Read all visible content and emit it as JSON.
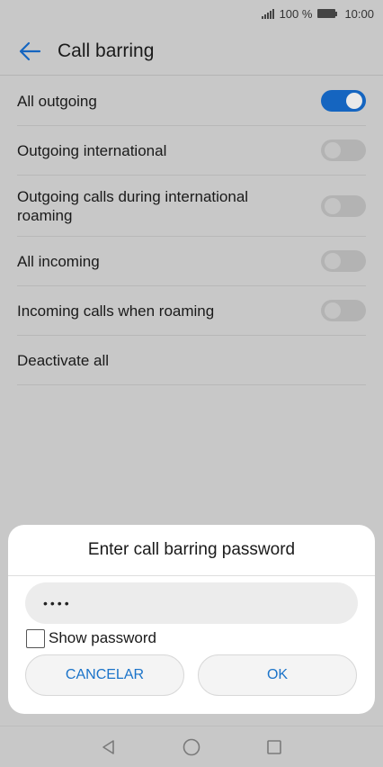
{
  "status_bar": {
    "battery_percent": "100 %",
    "time": "10:00",
    "icons": [
      "signal-icon",
      "battery-icon"
    ]
  },
  "header": {
    "title": "Call barring",
    "back_icon": "arrow-left-icon"
  },
  "settings": [
    {
      "label": "All outgoing",
      "toggle": true,
      "enabled": true
    },
    {
      "label": "Outgoing international",
      "toggle": true,
      "enabled": false
    },
    {
      "label": "Outgoing calls during international roaming",
      "toggle": true,
      "enabled": false
    },
    {
      "label": "All incoming",
      "toggle": true,
      "enabled": false
    },
    {
      "label": "Incoming calls when roaming",
      "toggle": true,
      "enabled": false
    },
    {
      "label": "Deactivate all",
      "toggle": false
    }
  ],
  "dialog": {
    "title": "Enter call barring password",
    "password_value": "••••",
    "show_password_label": "Show password",
    "show_password_checked": false,
    "cancel_label": "CANCELAR",
    "ok_label": "OK"
  },
  "nav_bar": {
    "icons": [
      "back-triangle-icon",
      "home-circle-icon",
      "recents-square-icon"
    ]
  },
  "colors": {
    "accent": "#1565c0",
    "button_text": "#1a73c9",
    "scrim_background": "#c8c8c8"
  }
}
